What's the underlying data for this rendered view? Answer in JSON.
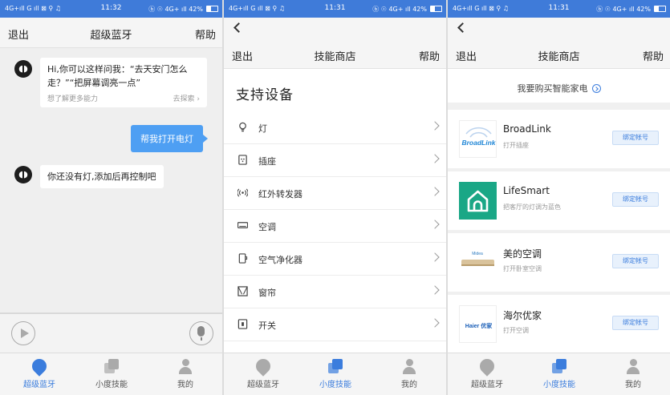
{
  "status_bar": {
    "left": "4G+ıll G ıll ⊠ ⚲ ♫",
    "right": "ⓑ ☉ 4G+ ıll 42%",
    "screens": [
      {
        "time": "11:32"
      },
      {
        "time": "11:31"
      },
      {
        "time": "11:31"
      }
    ]
  },
  "screen1": {
    "header": {
      "left": "退出",
      "title": "超级蓝牙",
      "right": "帮助"
    },
    "bot_message_1": "Hi,你可以这样问我：“去天安门怎么走？”“把屏幕调亮一点”",
    "hint_left": "想了解更多能力",
    "hint_right": "去探索",
    "user_message": "帮我打开电灯",
    "bot_message_2": "你还没有灯,添加后再控制吧"
  },
  "screen2": {
    "header": {
      "left": "退出",
      "title": "技能商店",
      "right": "帮助"
    },
    "section_title": "支持设备",
    "devices": [
      {
        "label": "灯",
        "icon": "bulb-icon"
      },
      {
        "label": "插座",
        "icon": "socket-icon"
      },
      {
        "label": "红外转发器",
        "icon": "infrared-icon"
      },
      {
        "label": "空调",
        "icon": "aircon-icon"
      },
      {
        "label": "空气净化器",
        "icon": "purifier-icon"
      },
      {
        "label": "窗帘",
        "icon": "curtain-icon"
      },
      {
        "label": "开关",
        "icon": "switch-icon"
      }
    ]
  },
  "screen3": {
    "header": {
      "left": "退出",
      "title": "技能商店",
      "right": "帮助"
    },
    "buy_link": "我要购买智能家电",
    "brands": [
      {
        "name": "BroadLink",
        "sub": "打开插座",
        "button": "绑定帐号",
        "logo_text": "BroadLink"
      },
      {
        "name": "LifeSmart",
        "sub": "把客厅的灯调为蓝色",
        "button": "绑定帐号",
        "logo_text": ""
      },
      {
        "name": "美的空调",
        "sub": "打开卧室空调",
        "button": "绑定帐号",
        "logo_text": "Midea"
      },
      {
        "name": "海尔优家",
        "sub": "打开空调",
        "button": "绑定帐号",
        "logo_text": "Haier 优家"
      }
    ]
  },
  "tabbar": {
    "tab1": "超级蓝牙",
    "tab2": "小度技能",
    "tab3": "我的"
  },
  "colors": {
    "accent": "#3b7ddd",
    "status_bar": "#3f7bd9",
    "user_bubble": "#4e9ff3",
    "lifesmart": "#1aa786"
  }
}
